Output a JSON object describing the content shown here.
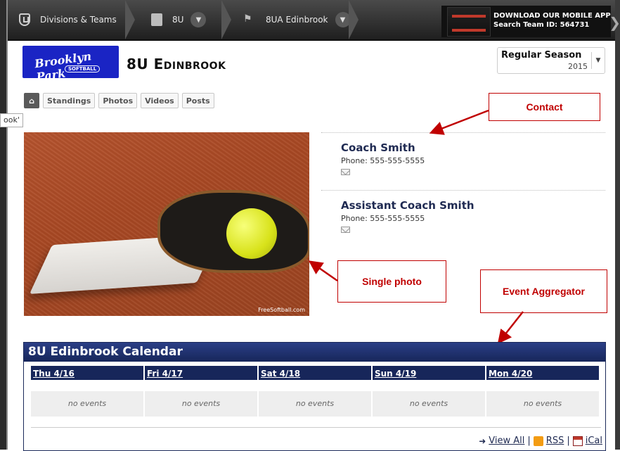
{
  "nav": {
    "divisions_label": "Divisions & Teams",
    "division_label": "8U",
    "team_label": "8UA Edinbrook",
    "promo_line1": "DOWNLOAD OUR MOBILE APP",
    "promo_line2": "Search Team ID: 564731"
  },
  "team": {
    "logo_text": "Brooklyn Park",
    "logo_sub": "SOFTBALL",
    "name": "8U Edinbrook",
    "season_label": "Regular Season",
    "season_year": "2015"
  },
  "tabs": [
    "Standings",
    "Photos",
    "Videos",
    "Posts"
  ],
  "tooltip": "ook'",
  "photo_credit": "FreeSoftball.com",
  "contacts": [
    {
      "name": "Coach Smith",
      "phone": "Phone: 555-555-5555"
    },
    {
      "name": "Assistant Coach Smith",
      "phone": "Phone: 555-555-5555"
    }
  ],
  "annotations": {
    "contact": "Contact",
    "single_photo": "Single photo",
    "event_aggregator": "Event Aggregator"
  },
  "calendar": {
    "title": "8U Edinbrook Calendar",
    "days": [
      {
        "label": "Thu 4/16",
        "events": "no events"
      },
      {
        "label": "Fri 4/17",
        "events": "no events"
      },
      {
        "label": "Sat 4/18",
        "events": "no events"
      },
      {
        "label": "Sun 4/19",
        "events": "no events"
      },
      {
        "label": "Mon 4/20",
        "events": "no events"
      }
    ],
    "view_all": "View All",
    "rss": "RSS",
    "ical": "iCal",
    "separator": "|"
  },
  "colors": {
    "nav_bg": "#2a2a2a",
    "brand_blue": "#1a24c4",
    "calendar_navy": "#17265a",
    "annotation_red": "#c00000"
  }
}
